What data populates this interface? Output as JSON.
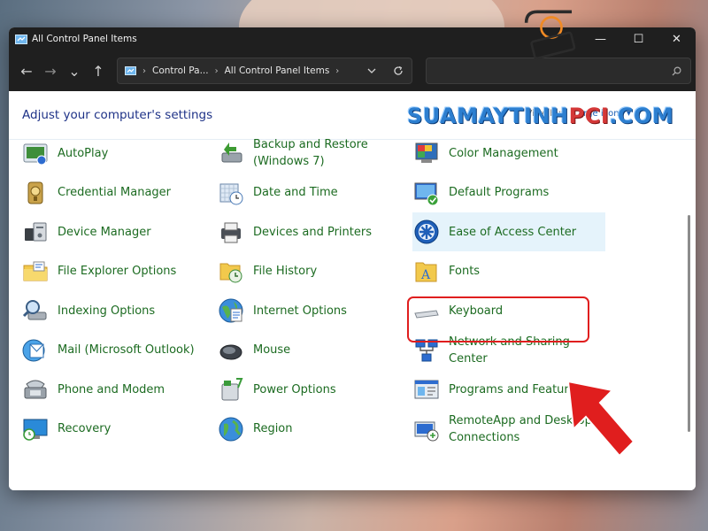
{
  "window": {
    "title": "All Control Panel Items",
    "controls": {
      "minimize": "—",
      "maximize": "☐",
      "close": "✕"
    }
  },
  "nav": {
    "back": "←",
    "forward": "→",
    "recent": "⌄",
    "up": "↑",
    "breadcrumb": [
      "Control Pa...",
      "All Control Panel Items"
    ],
    "search_value": ""
  },
  "header": {
    "title": "Adjust your computer's settings",
    "view_by_label": "View by:",
    "view_by_value": "Large icons ▾"
  },
  "watermark": {
    "main": "SUAMAYTINH",
    "accent": "PCI",
    "suffix": ".COM"
  },
  "items": [
    {
      "label": "AutoPlay",
      "icon": "autoplay-icon"
    },
    {
      "label": "Backup and Restore (Windows 7)",
      "icon": "backup-icon"
    },
    {
      "label": "Color Management",
      "icon": "color-management-icon"
    },
    {
      "label": "Credential Manager",
      "icon": "credential-icon"
    },
    {
      "label": "Date and Time",
      "icon": "calendar-clock-icon"
    },
    {
      "label": "Default Programs",
      "icon": "default-programs-icon"
    },
    {
      "label": "Device Manager",
      "icon": "device-manager-icon"
    },
    {
      "label": "Devices and Printers",
      "icon": "printer-icon"
    },
    {
      "label": "Ease of Access Center",
      "icon": "ease-of-access-icon"
    },
    {
      "label": "File Explorer Options",
      "icon": "folder-options-icon"
    },
    {
      "label": "File History",
      "icon": "file-history-icon"
    },
    {
      "label": "Fonts",
      "icon": "fonts-folder-icon"
    },
    {
      "label": "Indexing Options",
      "icon": "indexing-icon"
    },
    {
      "label": "Internet Options",
      "icon": "globe-icon"
    },
    {
      "label": "Keyboard",
      "icon": "keyboard-icon"
    },
    {
      "label": "Mail (Microsoft Outlook)",
      "icon": "mail-icon"
    },
    {
      "label": "Mouse",
      "icon": "mouse-icon"
    },
    {
      "label": "Network and Sharing Center",
      "icon": "network-icon"
    },
    {
      "label": "Phone and Modem",
      "icon": "phone-icon"
    },
    {
      "label": "Power Options",
      "icon": "power-icon"
    },
    {
      "label": "Programs and Features",
      "icon": "programs-icon"
    },
    {
      "label": "Recovery",
      "icon": "recovery-icon"
    },
    {
      "label": "Region",
      "icon": "region-icon"
    },
    {
      "label": "RemoteApp and Desktop Connections",
      "icon": "remoteapp-icon"
    }
  ],
  "colors": {
    "link_green": "#1c6b21",
    "header_blue": "#1e3287",
    "highlight_red": "#e01e1e",
    "selected_bg": "#e5f3fb"
  }
}
